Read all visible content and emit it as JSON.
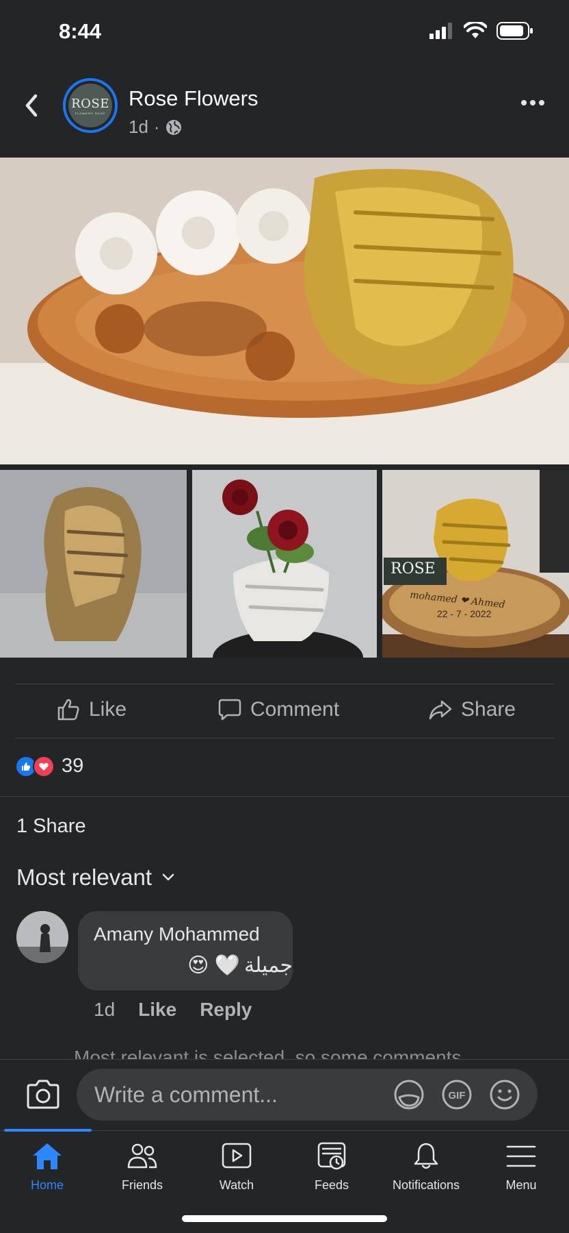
{
  "status_bar": {
    "time": "8:44"
  },
  "post": {
    "page_name": "Rose Flowers",
    "age": "1d",
    "separator": "·",
    "avatar_logo": "ROSE",
    "avatar_logo_sub": "FLOWERS SHOP",
    "photo3_badge": "ROSE",
    "photo3_engraving": "mohamed ❤ Ahmed",
    "photo3_date": "22 - 7 - 2022"
  },
  "actions": {
    "like": "Like",
    "comment": "Comment",
    "share": "Share"
  },
  "engagement": {
    "reaction_count": "39",
    "share_count": "1 Share"
  },
  "comments_section": {
    "sort_label": "Most relevant",
    "hint": "Most relevant is selected, so some comments"
  },
  "comment": {
    "author": "Amany Mohammed",
    "text": "جميلة",
    "emojis": "😍 🤍",
    "age": "1d",
    "like_label": "Like",
    "reply_label": "Reply"
  },
  "composer": {
    "placeholder": "Write a comment..."
  },
  "tabs": [
    {
      "label": "Home",
      "icon": "home-icon",
      "active": true
    },
    {
      "label": "Friends",
      "icon": "friends-icon"
    },
    {
      "label": "Watch",
      "icon": "watch-icon"
    },
    {
      "label": "Feeds",
      "icon": "feeds-icon"
    },
    {
      "label": "Notifications",
      "icon": "bell-icon"
    },
    {
      "label": "Menu",
      "icon": "menu-icon"
    }
  ],
  "colors": {
    "background": "#242526",
    "accent": "#2d88ff",
    "like_blue": "#1877f2",
    "love_red": "#f33e58"
  }
}
